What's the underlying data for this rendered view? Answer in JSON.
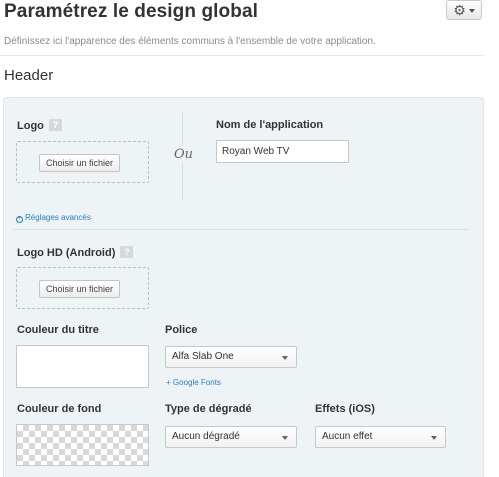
{
  "header": {
    "title": "Paramétrez le design global",
    "subtitle": "Définissez ici l'apparence des éléments communs à l'ensemble de votre application.",
    "settings_icon": "gear-icon"
  },
  "section": {
    "title": "Header"
  },
  "logo": {
    "label": "Logo",
    "help": "?",
    "file_button": "Choisir un fichier"
  },
  "separator_or": "Ou",
  "app_name": {
    "label": "Nom de l'application",
    "value": "Royan Web TV"
  },
  "advanced_link": "Réglages avancés",
  "logo_hd": {
    "label": "Logo HD (Android)",
    "help": "?",
    "file_button": "Choisir un fichier"
  },
  "title_color": {
    "label": "Couleur du titre"
  },
  "font": {
    "label": "Police",
    "selected": "Alfa Slab One",
    "link": "+ Google Fonts"
  },
  "background_color": {
    "label": "Couleur de fond"
  },
  "gradient": {
    "label": "Type de dégradé",
    "selected": "Aucun dégradé"
  },
  "effects": {
    "label": "Effets (iOS)",
    "selected": "Aucun effet"
  },
  "colors": {
    "panel_bg": "#eef3f6",
    "link": "#2a7fc0"
  }
}
